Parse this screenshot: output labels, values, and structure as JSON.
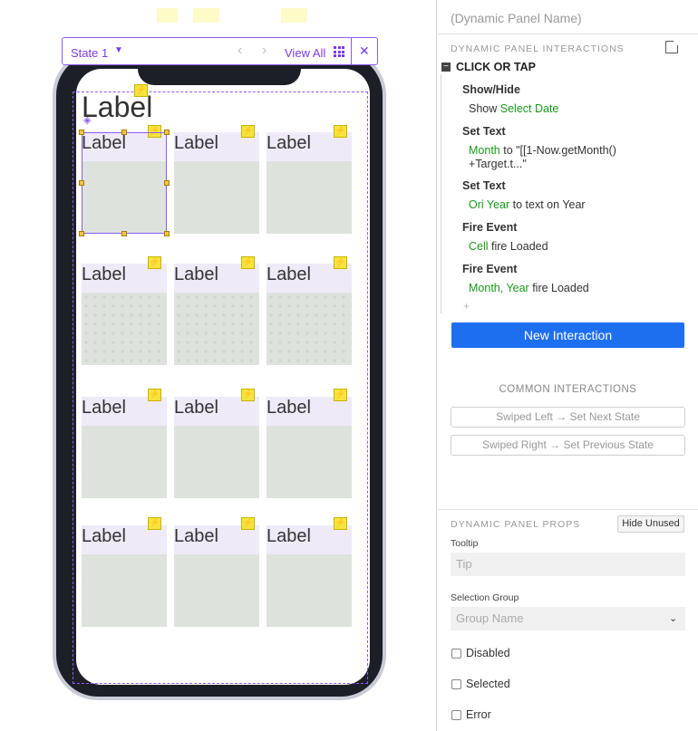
{
  "statebar": {
    "state_label": "State 1",
    "view_all_label": "View All"
  },
  "canvas": {
    "big_label": "Label",
    "cell_label": "Label"
  },
  "panel": {
    "name_placeholder": "(Dynamic Panel Name)",
    "interactions_title": "DYNAMIC PANEL INTERACTIONS",
    "event_title": "CLICK OR TAP",
    "actions": [
      {
        "title": "Show/Hide",
        "target": "Select Date",
        "prefix": "Show ",
        "rest": ""
      },
      {
        "title": "Set Text",
        "target": "Month",
        "prefix": "",
        "rest": " to \"[[1-Now.getMonth()",
        "rest2": "+Target.t...\""
      },
      {
        "title": "Set Text",
        "target": "Ori Year",
        "prefix": "",
        "rest": " to text on Year"
      },
      {
        "title": "Fire Event",
        "target": "Cell",
        "prefix": "",
        "rest": " fire Loaded"
      },
      {
        "title": "Fire Event",
        "target": "Month, Year",
        "prefix": "",
        "rest": " fire Loaded"
      }
    ],
    "new_interaction_label": "New Interaction",
    "common_title": "COMMON INTERACTIONS",
    "common_buttons": [
      "Swiped Left → Set Next State",
      "Swiped Right → Set Previous State"
    ],
    "props_title": "DYNAMIC PANEL PROPS",
    "hide_unused_label": "Hide Unused",
    "tooltip_label": "Tooltip",
    "tooltip_placeholder": "Tip",
    "selection_group_label": "Selection Group",
    "selection_group_placeholder": "Group Name",
    "checkboxes": [
      "Disabled",
      "Selected",
      "Error"
    ]
  }
}
